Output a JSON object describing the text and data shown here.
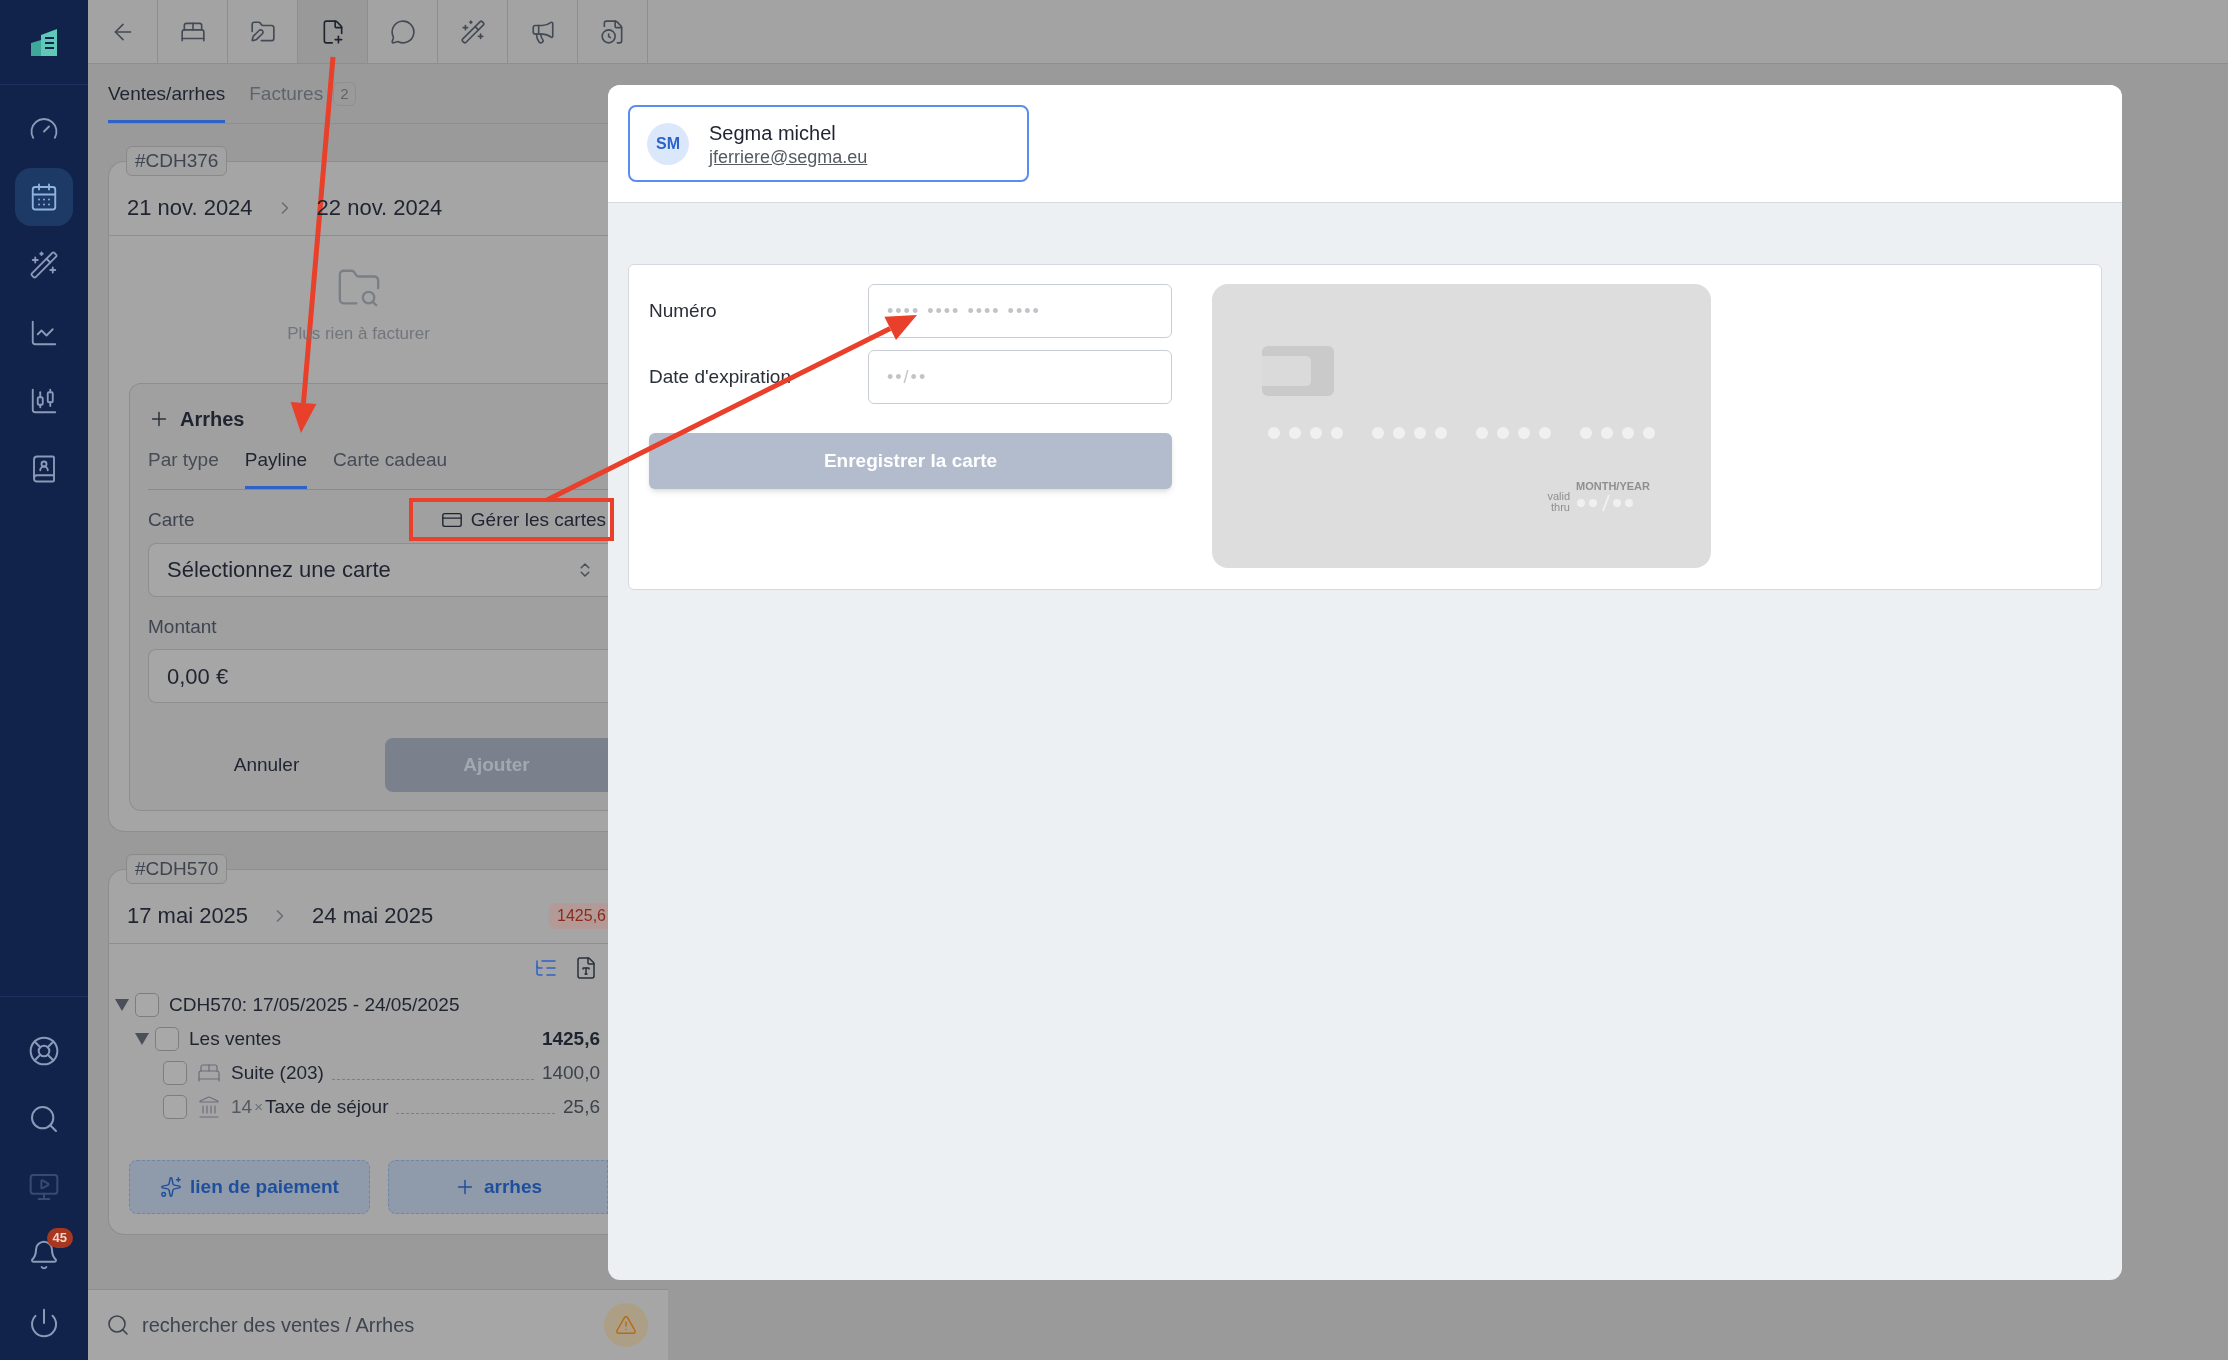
{
  "sidebar": {
    "top_items": [
      {
        "selected": false
      },
      {
        "selected": true
      },
      {
        "selected": false
      },
      {
        "selected": false
      },
      {
        "selected": false
      },
      {
        "selected": false
      }
    ],
    "bottom_items": [
      {
        "disabled": false
      },
      {
        "disabled": false
      },
      {
        "disabled": true
      },
      {
        "disabled": false,
        "badge": "45"
      },
      {
        "disabled": false
      }
    ]
  },
  "toolbar": {
    "buttons": [
      {
        "selected": false
      },
      {
        "selected": false
      },
      {
        "selected": false
      },
      {
        "selected": true
      },
      {
        "selected": false
      },
      {
        "selected": false
      },
      {
        "selected": false
      },
      {
        "selected": false
      }
    ]
  },
  "tabs": [
    {
      "label": "Ventes/arrhes",
      "selected": true
    },
    {
      "label": "Factures",
      "badge": "2",
      "selected": false
    }
  ],
  "bookings": [
    {
      "tag": "#CDH376",
      "start": "21 nov. 2024",
      "end": "22 nov. 2024",
      "empty_state": "Plus rien à facturer",
      "deposit_form": {
        "title": "Arrhes",
        "tabs": [
          {
            "label": "Par type",
            "selected": false
          },
          {
            "label": "Payline",
            "selected": true
          },
          {
            "label": "Carte cadeau",
            "selected": false
          }
        ],
        "card_label": "Carte",
        "manage_link": "Gérer les cartes",
        "select_placeholder": "Sélectionnez une carte",
        "amount_label": "Montant",
        "amount_value": "0,00 €",
        "cancel": "Annuler",
        "submit": {
          "label": "Ajouter",
          "disabled": true
        }
      }
    },
    {
      "tag": "#CDH570",
      "start": "17 mai 2025",
      "end": "24 mai 2025",
      "total_badge": "1425,6",
      "tree": [
        {
          "label": "CDH570: 17/05/2025 - 24/05/2025",
          "checked": false,
          "expanded": true,
          "children": [
            {
              "label": "Les ventes",
              "amount": "1425,6",
              "checked": false,
              "expanded": true,
              "children": [
                {
                  "kind": "room",
                  "label": "Suite (203)",
                  "amount": "1400,0",
                  "checked": false
                },
                {
                  "kind": "tax",
                  "quantity": "14",
                  "times": "×",
                  "label": "Taxe de séjour",
                  "amount": "25,6",
                  "checked": false
                }
              ]
            }
          ]
        }
      ],
      "actions": [
        {
          "kind": "link",
          "label": "lien de paiement"
        },
        {
          "kind": "add",
          "label": "arrhes"
        }
      ]
    }
  ],
  "search": {
    "placeholder": "rechercher des ventes / Arrhes"
  },
  "modal": {
    "contact": {
      "initials": "SM",
      "name": "Segma michel",
      "email": "jferriere@segma.eu"
    },
    "card_form": {
      "fields": [
        {
          "label": "Numéro",
          "placeholder": "•••• •••• •••• ••••"
        },
        {
          "label": "Date d'expiration",
          "placeholder": "••/••"
        }
      ],
      "submit": {
        "label": "Enregistrer la carte",
        "disabled": true
      },
      "preview": {
        "expiry_caption": "MONTH/YEAR",
        "valid_label": "valid thru"
      }
    }
  }
}
